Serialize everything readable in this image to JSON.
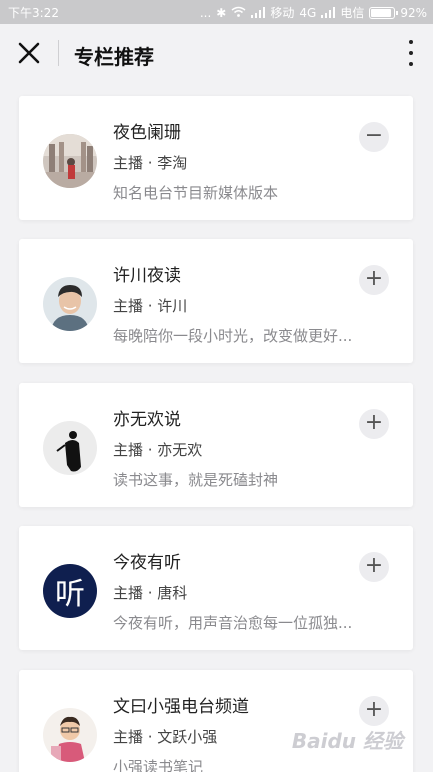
{
  "status_bar": {
    "time": "下午3:22",
    "dots": "...",
    "carrier1": "移动",
    "network": "4G",
    "carrier2": "电信",
    "battery": "92%"
  },
  "nav": {
    "title": "专栏推荐"
  },
  "columns": [
    {
      "title": "夜色阑珊",
      "host": "主播 · 李淘",
      "desc": "知名电台节目新媒体版本",
      "action": "−"
    },
    {
      "title": "许川夜读",
      "host": "主播 · 许川",
      "desc": "每晚陪你一段小时光，改变做更好...",
      "action": "+"
    },
    {
      "title": "亦无欢说",
      "host": "主播 · 亦无欢",
      "desc": "读书这事，就是死磕封神",
      "action": "+"
    },
    {
      "title": "今夜有听",
      "host": "主播 · 唐科",
      "desc": "今夜有听，用声音治愈每一位孤独...",
      "action": "+"
    },
    {
      "title": "文曰小强电台频道",
      "host": "主播 · 文跃小强",
      "desc": "小强读书笔记",
      "action": "+"
    }
  ],
  "avatar4_text": "听",
  "watermark": "Baidu 经验"
}
